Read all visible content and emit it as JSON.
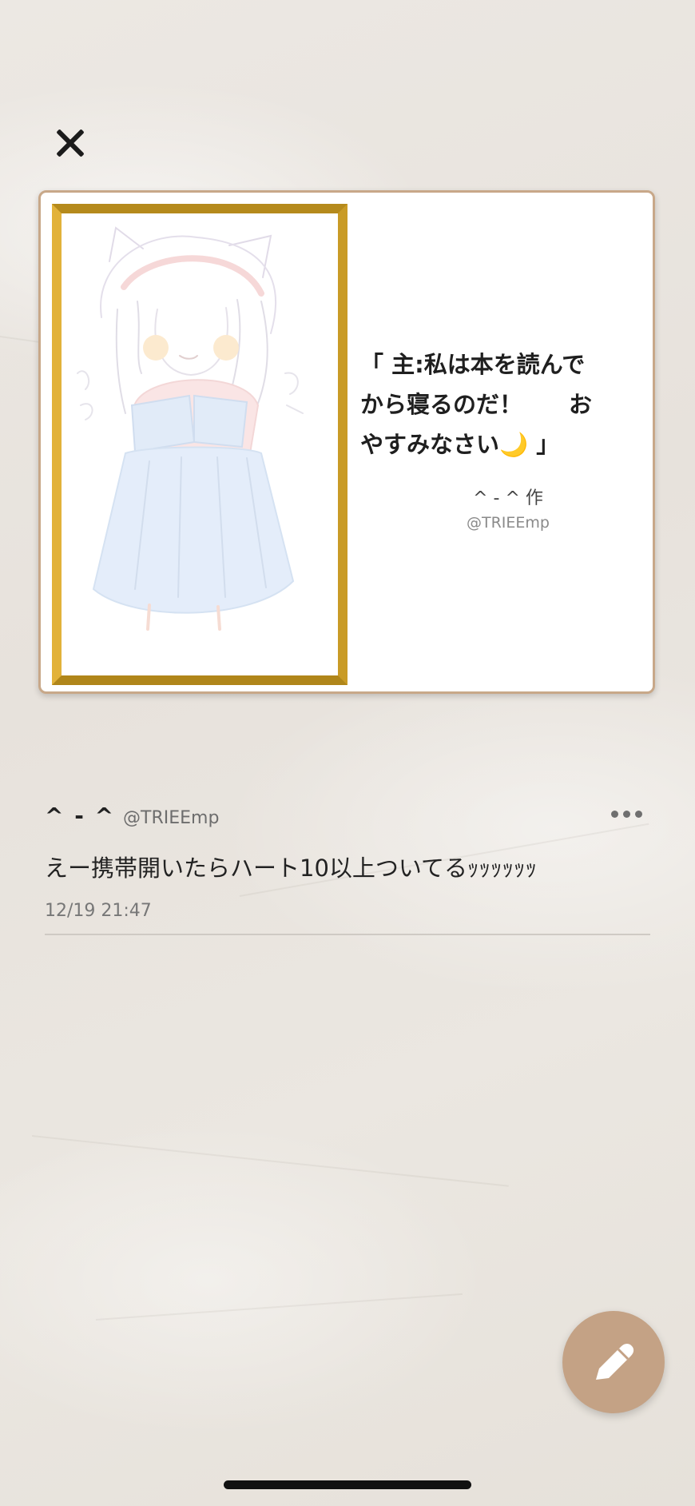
{
  "toolbar": {
    "close_icon": "close-icon"
  },
  "card": {
    "quote": "「 主:私は本を読んで\nから寝るのだ！　　お\nやすみなさい🌙 」",
    "author": "^ - ^ 作",
    "handle": "@TRIEEmp",
    "image": "drawing-of-girl-reading-book"
  },
  "post": {
    "name": "^ - ^",
    "handle": "@TRIEEmp",
    "body": "えー携帯開いたらハート10以上ついてるｯｯｯｯｯｯ",
    "time": "12/19 21:47",
    "more_icon": "more-options-icon"
  },
  "fab": {
    "icon": "pencil-icon"
  },
  "colors": {
    "card_border": "#c8a889",
    "frame_gold": "#d9a92f",
    "fab_bg": "#c4a285"
  }
}
